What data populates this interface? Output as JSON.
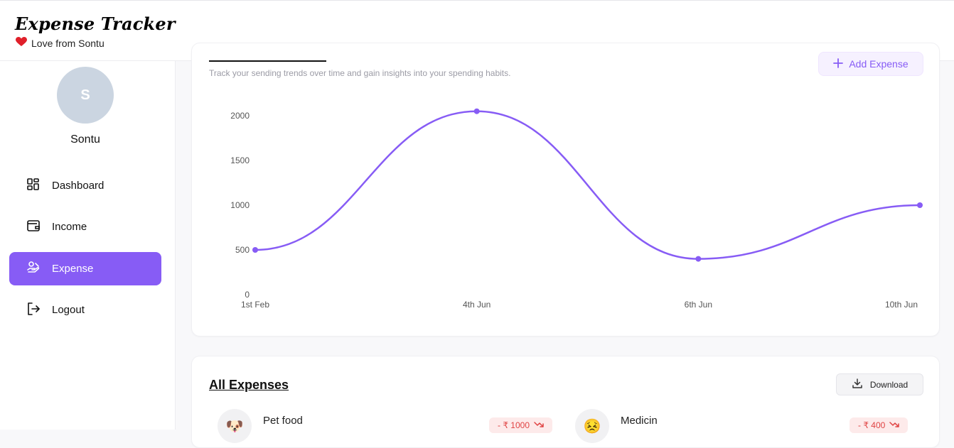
{
  "app": {
    "brand": "Expense Tracker",
    "tagline": "Love from Sontu"
  },
  "user": {
    "initial": "S",
    "name": "Sontu"
  },
  "sidebar": {
    "items": [
      {
        "label": "Dashboard",
        "icon": "dashboard-icon",
        "active": false
      },
      {
        "label": "Income",
        "icon": "wallet-icon",
        "active": false
      },
      {
        "label": "Expense",
        "icon": "expense-hand-icon",
        "active": true
      },
      {
        "label": "Logout",
        "icon": "logout-icon",
        "active": false
      }
    ]
  },
  "overview": {
    "subtitle": "Track your sending trends over time and gain insights into your spending habits.",
    "add_button": "Add Expense"
  },
  "chart_data": {
    "type": "line",
    "categories": [
      "1st Feb",
      "4th Jun",
      "6th Jun",
      "10th Jun"
    ],
    "series": [
      {
        "values": [
          500,
          2050,
          400,
          1000
        ]
      }
    ],
    "yticks": [
      "0",
      "500",
      "1000",
      "1500",
      "2000"
    ],
    "ylim": [
      0,
      2000
    ],
    "grid": false,
    "line_color": "#875cf5"
  },
  "expenses": {
    "title": "All Expenses",
    "download_label": "Download",
    "items": [
      {
        "name": "Pet food",
        "emoji": "🐶",
        "amount": "- ₹ 1000"
      },
      {
        "name": "Medicin",
        "emoji": "😣",
        "amount": "- ₹ 400"
      }
    ]
  },
  "colors": {
    "accent": "#875cf5",
    "expense_red": "#e04343"
  }
}
